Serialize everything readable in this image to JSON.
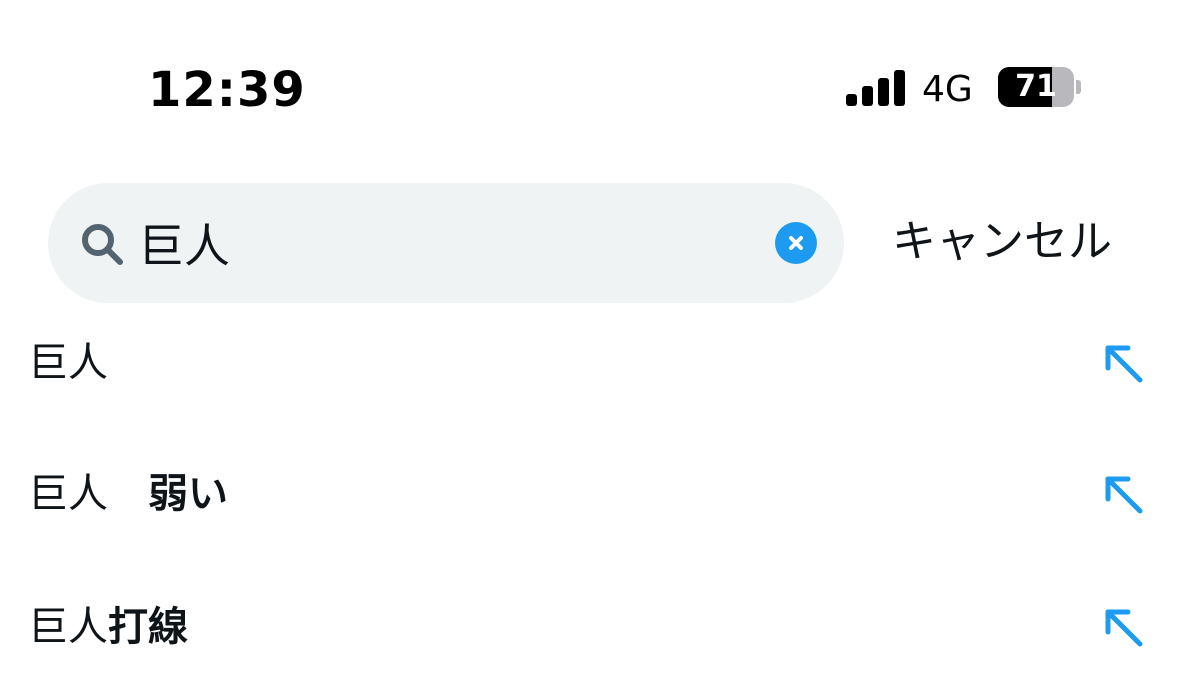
{
  "status_bar": {
    "time": "12:39",
    "network": "4G",
    "battery_level": "71",
    "battery_percent": 71
  },
  "search": {
    "query": "巨人",
    "cancel_label": "キャンセル"
  },
  "suggestions": [
    {
      "prefix": "巨人",
      "completion": ""
    },
    {
      "prefix": "巨人　",
      "completion": "弱い"
    },
    {
      "prefix": "巨人",
      "completion": "打線"
    }
  ],
  "colors": {
    "accent": "#1d9bf0",
    "search_bg": "#eff3f4",
    "text": "#0f1419",
    "icon_gray": "#536471"
  },
  "icons": {
    "search": "search-icon",
    "clear": "clear-icon",
    "fill_suggestion": "arrow-up-left-icon"
  }
}
